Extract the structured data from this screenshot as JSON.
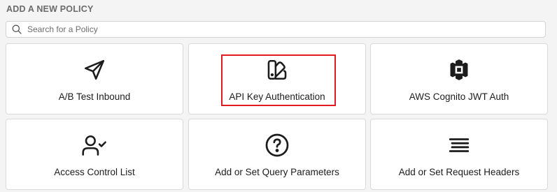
{
  "section": {
    "title": "ADD A NEW POLICY"
  },
  "search": {
    "placeholder": "Search for a Policy",
    "icon": "search-icon"
  },
  "policies": [
    {
      "label": "A/B Test Inbound",
      "icon": "send-icon"
    },
    {
      "label": "API Key Authentication",
      "icon": "swatchbook-icon",
      "highlighted": true
    },
    {
      "label": "AWS Cognito JWT Auth",
      "icon": "aws-cognito-icon"
    },
    {
      "label": "Access Control List",
      "icon": "user-check-icon"
    },
    {
      "label": "Add or Set Query Parameters",
      "icon": "question-circle-icon"
    },
    {
      "label": "Add or Set Request Headers",
      "icon": "align-justify-icon"
    }
  ],
  "colors": {
    "background": "#f4f4f4",
    "card": "#ffffff",
    "highlight": "#e11b22"
  }
}
